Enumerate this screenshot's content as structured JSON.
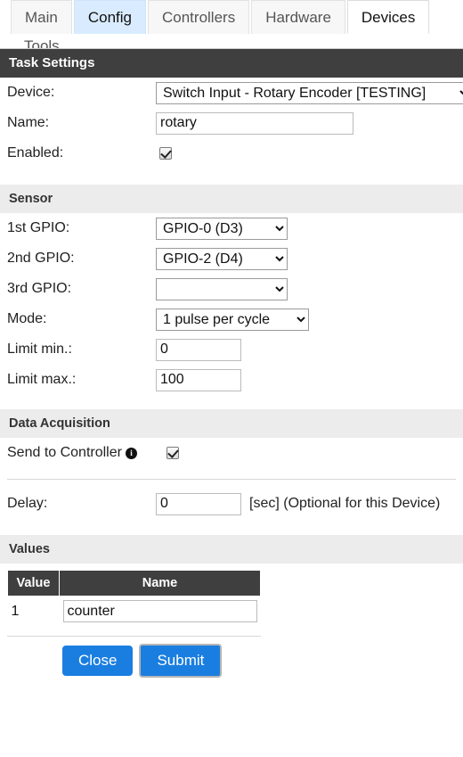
{
  "nav": {
    "tabs": [
      {
        "label": "Main",
        "state": "plain"
      },
      {
        "label": "Config",
        "state": "hovered"
      },
      {
        "label": "Controllers",
        "state": "plain"
      },
      {
        "label": "Hardware",
        "state": "plain"
      },
      {
        "label": "Devices",
        "state": "active"
      }
    ],
    "second_row": "Tools"
  },
  "task_settings": {
    "header": "Task Settings",
    "device_label": "Device:",
    "device_value": "Switch Input - Rotary Encoder [TESTING]",
    "name_label": "Name:",
    "name_value": "rotary",
    "name_placeholder": "",
    "enabled_label": "Enabled:",
    "enabled_checked": true
  },
  "sensor": {
    "header": "Sensor",
    "gpio1_label": "1st GPIO:",
    "gpio1_value": "GPIO-0 (D3)",
    "gpio2_label": "2nd GPIO:",
    "gpio2_value": "GPIO-2 (D4)",
    "gpio3_label": "3rd GPIO:",
    "gpio3_value": "",
    "mode_label": "Mode:",
    "mode_value": "1 pulse per cycle",
    "limit_min_label": "Limit min.:",
    "limit_min_value": "0",
    "limit_max_label": "Limit max.:",
    "limit_max_value": "100"
  },
  "data_acquisition": {
    "header": "Data Acquisition",
    "send_to_controller_label": "Send to Controller",
    "info_glyph": "i",
    "send_to_controller_checked": true,
    "delay_label": "Delay:",
    "delay_value": "0",
    "delay_suffix": "[sec] (Optional for this Device)"
  },
  "values": {
    "header": "Values",
    "columns": [
      "Value",
      "Name"
    ],
    "rows": [
      {
        "value": "1",
        "name": "counter"
      }
    ]
  },
  "buttons": {
    "close_label": "Close",
    "submit_label": "Submit",
    "accent_color": "#1a7ee0"
  }
}
